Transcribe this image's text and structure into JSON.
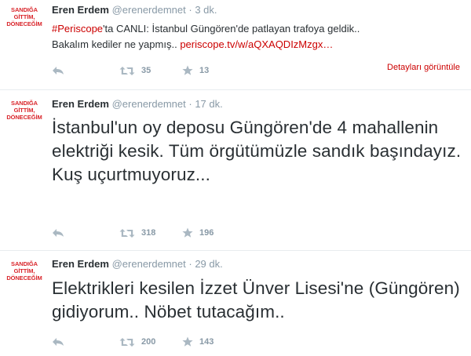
{
  "avatar": {
    "line1": "SANDIĞA",
    "line2": "GİTTİM,",
    "line3": "DÖNECEĞİM"
  },
  "tweets": [
    {
      "name": "Eren Erdem",
      "handle": "@erenerdemnet",
      "time": "· 3 dk.",
      "hashtag": "#Periscope",
      "text_a": "'ta CANLI: İstanbul Güngören'de patlayan trafoya geldik..",
      "text_b": "Bakalım kediler ne yapmış..",
      "link": "periscope.tv/w/aQXAQDIzMzgx…",
      "details": "Detayları görüntüle",
      "retweets": "35",
      "favorites": "13"
    },
    {
      "name": "Eren Erdem",
      "handle": "@erenerdemnet",
      "time": "· 17 dk.",
      "text": "İstanbul'un oy deposu Güngören'de 4 mahallenin elektriği kesik. Tüm örgütümüzle sandık başındayız. Kuş uçurtmuyoruz...",
      "retweets": "318",
      "favorites": "196"
    },
    {
      "name": "Eren Erdem",
      "handle": "@erenerdemnet",
      "time": "· 29 dk.",
      "text": "Elektrikleri kesilen İzzet Ünver Lisesi'ne (Güngören) gidiyorum.. Nöbet tutacağım..",
      "retweets": "200",
      "favorites": "143"
    }
  ]
}
